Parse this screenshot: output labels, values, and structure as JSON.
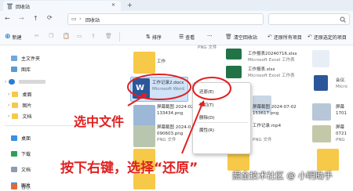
{
  "window": {
    "tab_title": "回收站",
    "close_glyph": "✕",
    "new_tab_glyph": "+"
  },
  "nav": {
    "back": "←",
    "forward": "→",
    "up": "↑",
    "refresh": "⟳",
    "view_glyph": "▭",
    "chevron": "›",
    "address": "回收站"
  },
  "toolbar": {
    "new_label": "新建",
    "sort_label": "排序",
    "view_label": "查看",
    "more_label": "···",
    "empty_bin_label": "清空回收站",
    "restore_all_label": "还原所有项目",
    "restore_selected_label": "还原选定的项目"
  },
  "sidebar": {
    "items": [
      {
        "label": "主文件夹"
      },
      {
        "label": "图库"
      },
      {
        "label": ""
      },
      {
        "label": "桌面"
      },
      {
        "label": "图片"
      },
      {
        "label": "文档"
      },
      {
        "label": "桌面"
      },
      {
        "label": "下载"
      },
      {
        "label": "文档"
      },
      {
        "label": "图片"
      },
      {
        "label": "音乐"
      }
    ]
  },
  "files": [
    {
      "name": "工作",
      "sub": ""
    },
    {
      "name": "工作记录2.docx",
      "sub": "Microsoft Word"
    },
    {
      "name": "屏幕截图 2024-02-",
      "sub": "133434.png"
    },
    {
      "name": "屏幕截图 2024-0",
      "sub": "090603.png"
    },
    {
      "name": "PNG 文件",
      "sub": ""
    },
    {
      "name": "工作报表20240716.xlsx",
      "sub": "Microsoft Excel 工作表"
    },
    {
      "name": "工作报表.xlsx",
      "sub": "Microsoft Excel 工作表"
    },
    {
      "name": "屏幕截图 2024-07-02",
      "sub": "153617.png"
    },
    {
      "name": "工作记录.mp4",
      "sub": ""
    },
    {
      "name": "PNG 文件",
      "sub": ""
    },
    {
      "name": "会议.",
      "sub": "Micro"
    },
    {
      "name": "屏幕",
      "sub": "1701"
    },
    {
      "name": "屏幕",
      "sub": "0721"
    },
    {
      "name": "PNG",
      "sub": ""
    }
  ],
  "context_menu": {
    "items": [
      {
        "label": "还原(E)"
      },
      {
        "label": "剪切(T)"
      },
      {
        "label": "删除(D)"
      },
      {
        "label": "属性(R)"
      }
    ]
  },
  "annotations": {
    "step1": "选中文件",
    "step2": "按下右键，选择“还原”"
  },
  "watermark": "掘金技术社区 @ 小明助手",
  "colors": {
    "accent": "#0067c0",
    "annotation_red": "#e02020",
    "folder_yellow": "#f7c948",
    "selection_blue": "#cfe3f9"
  }
}
